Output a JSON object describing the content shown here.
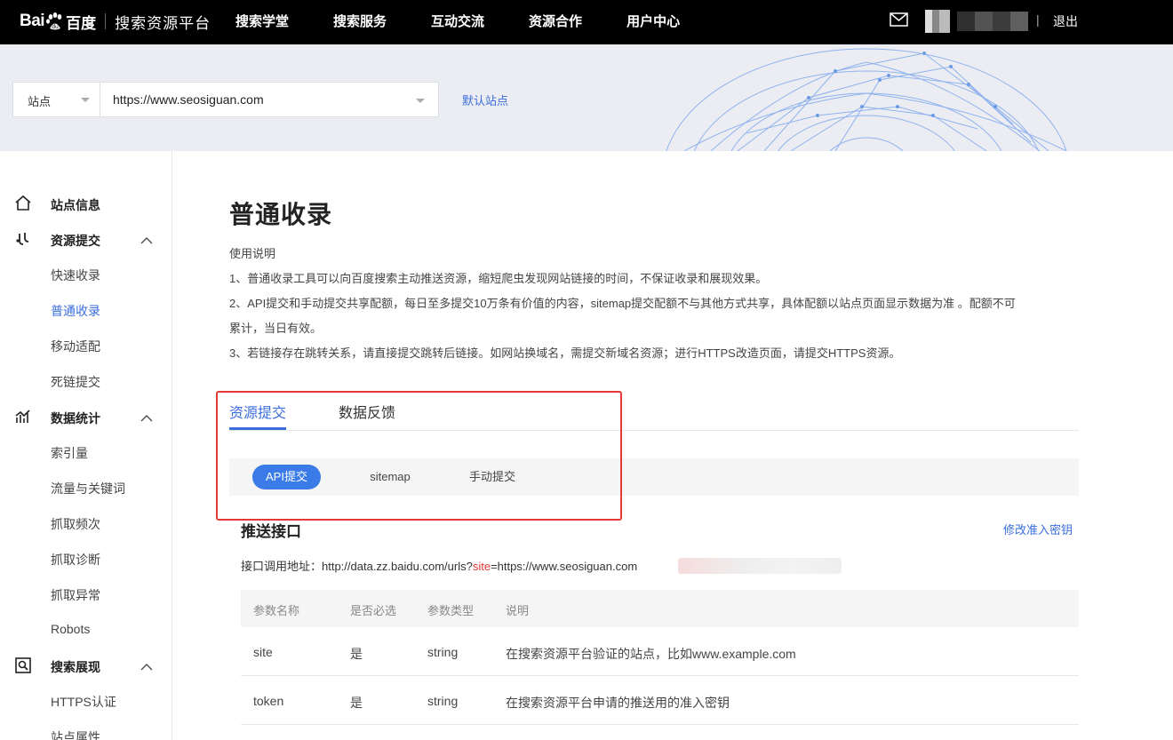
{
  "header": {
    "logo_bai": "Bai",
    "logo_du": "百度",
    "platform_title": "搜索资源平台",
    "nav": [
      "搜索学堂",
      "搜索服务",
      "互动交流",
      "资源合作",
      "用户中心"
    ],
    "separator": "|",
    "logout": "退出"
  },
  "banner": {
    "site_select_label": "站点",
    "site_url": "https://www.seosiguan.com",
    "default_site_link": "默认站点"
  },
  "sidebar": {
    "groups": [
      {
        "label": "站点信息",
        "icon": "home-icon",
        "items": []
      },
      {
        "label": "资源提交",
        "icon": "link-icon",
        "items": [
          "快速收录",
          "普通收录",
          "移动适配",
          "死链提交"
        ]
      },
      {
        "label": "数据统计",
        "icon": "stats-icon",
        "items": [
          "索引量",
          "流量与关键词",
          "抓取频次",
          "抓取诊断",
          "抓取异常",
          "Robots"
        ]
      },
      {
        "label": "搜索展现",
        "icon": "search-display-icon",
        "items": [
          "HTTPS认证",
          "站点属性"
        ]
      }
    ],
    "active_item": "普通收录"
  },
  "main": {
    "title": "普通收录",
    "usage_heading": "使用说明",
    "usage_lines": [
      "1、普通收录工具可以向百度搜索主动推送资源，缩短爬虫发现网站链接的时间，不保证收录和展现效果。",
      "2、API提交和手动提交共享配额，每日至多提交10万条有价值的内容，sitemap提交配额不与其他方式共享，具体配额以站点页面显示数据为准 。配额不可",
      "累计，当日有效。",
      "3、若链接存在跳转关系，请直接提交跳转后链接。如网站换域名，需提交新域名资源；进行HTTPS改造页面，请提交HTTPS资源。"
    ],
    "tabs": [
      "资源提交",
      "数据反馈"
    ],
    "subtabs": [
      "API提交",
      "sitemap",
      "手动提交"
    ],
    "section_title": "推送接口",
    "edit_key_link": "修改准入密钥",
    "api_addr_prefix": "接口调用地址：http://data.zz.baidu.com/urls?",
    "api_addr_highlight": "site",
    "api_addr_suffix": "=https://www.seosiguan.com",
    "table": {
      "headers": [
        "参数名称",
        "是否必选",
        "参数类型",
        "说明"
      ],
      "rows": [
        [
          "site",
          "是",
          "string",
          "在搜索资源平台验证的站点，比如www.example.com"
        ],
        [
          "token",
          "是",
          "string",
          "在搜索资源平台申请的推送用的准入密钥"
        ]
      ]
    }
  },
  "colors": {
    "accent": "#3a6edd",
    "highlight_box": "#e43a36",
    "topbar": "#000000"
  }
}
